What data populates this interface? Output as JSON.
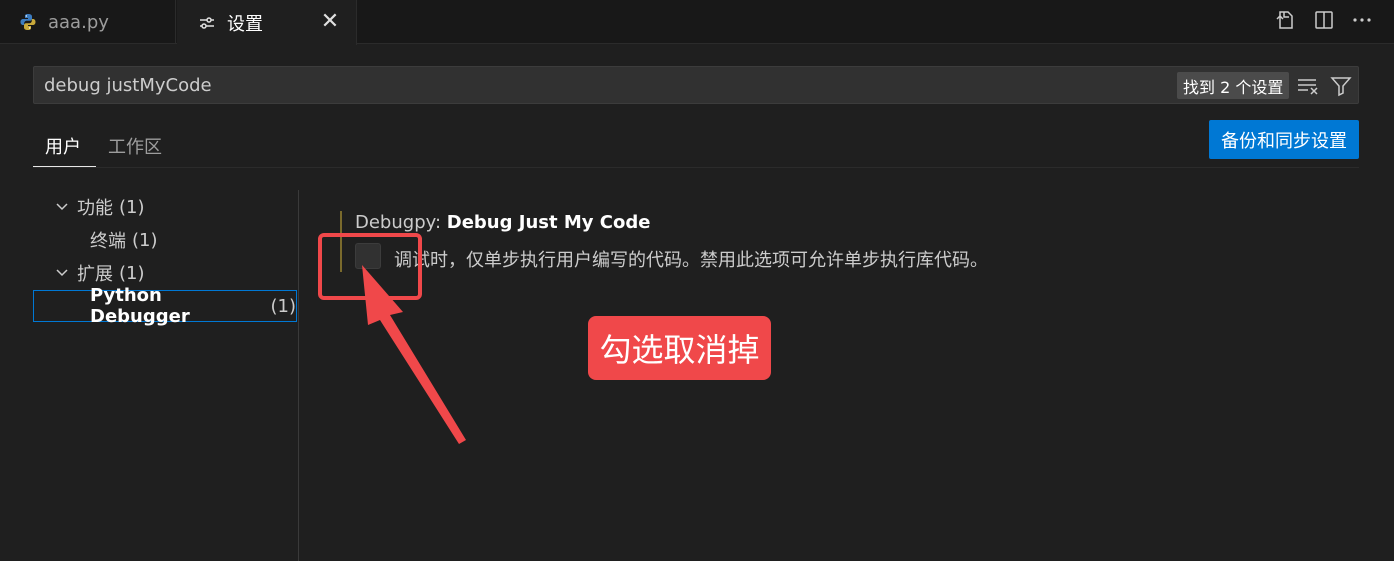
{
  "tabs": [
    {
      "label": "aaa.py",
      "icon": "python-file-icon"
    },
    {
      "label": "设置",
      "icon": "settings-sliders-icon",
      "close": "✕"
    }
  ],
  "editor_actions": [
    "open-settings-json-icon",
    "split-editor-icon",
    "more-actions-icon"
  ],
  "search": {
    "value": "debug justMyCode",
    "result_badge": "找到 2 个设置"
  },
  "scope_tabs": {
    "user": "用户",
    "workspace": "工作区"
  },
  "sync_button": "备份和同步设置",
  "tree": {
    "features": {
      "label": "功能",
      "count": "(1)"
    },
    "terminal": {
      "label": "终端",
      "count": "(1)"
    },
    "extensions": {
      "label": "扩展",
      "count": "(1)"
    },
    "python_debugger": {
      "label": "Python Debugger",
      "count": "(1)"
    }
  },
  "setting": {
    "prefix": "Debugpy: ",
    "name": "Debug Just My Code",
    "checked": false,
    "description": "调试时，仅单步执行用户编写的代码。禁用此选项可允许单步执行库代码。"
  },
  "annotation": {
    "callout_text": "勾选取消掉",
    "color": "#f0484a"
  },
  "colors": {
    "accent": "#0078d4",
    "background": "#1f1f1f",
    "modified_indicator": "#7a6a2c"
  }
}
